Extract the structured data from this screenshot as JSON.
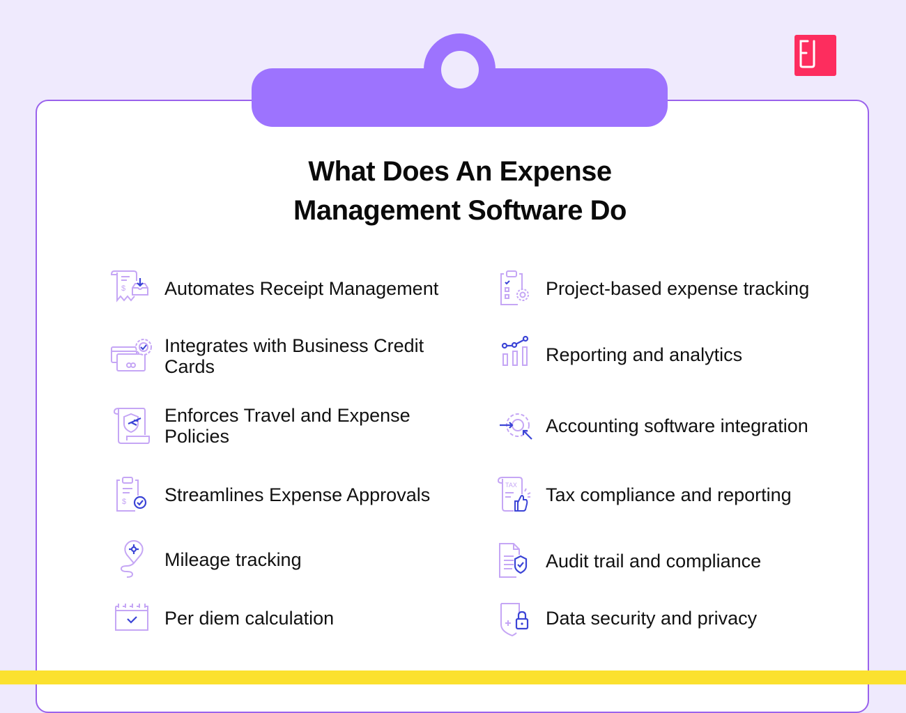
{
  "brand": {
    "logo_label": "FJ",
    "logo_color": "#fd2d5e"
  },
  "colors": {
    "background": "#efeafd",
    "accent": "#9d73fe",
    "border": "#9a62ec",
    "icon_light": "#c5a6f5",
    "icon_dark": "#3b44d6",
    "footer": "#fbe12f"
  },
  "title": {
    "line1": "What Does An Expense",
    "line2": "Management Software Do"
  },
  "left_column": [
    {
      "icon": "receipt-download-icon",
      "label": "Automates Receipt Management"
    },
    {
      "icon": "credit-card-gear-icon",
      "label": "Integrates with Business Credit Cards"
    },
    {
      "icon": "travel-policy-scroll-icon",
      "label": "Enforces Travel and Expense Policies"
    },
    {
      "icon": "clipboard-approval-icon",
      "label": "Streamlines Expense Approvals"
    },
    {
      "icon": "map-pin-route-icon",
      "label": "Mileage tracking"
    },
    {
      "icon": "calendar-check-icon",
      "label": "Per diem calculation"
    }
  ],
  "right_column": [
    {
      "icon": "clipboard-gear-icon",
      "label": "Project-based expense tracking"
    },
    {
      "icon": "bar-chart-trend-icon",
      "label": "Reporting and analytics"
    },
    {
      "icon": "gear-integration-icon",
      "label": "Accounting software integration"
    },
    {
      "icon": "tax-thumbs-up-icon",
      "label": "Tax compliance and reporting"
    },
    {
      "icon": "document-shield-icon",
      "label": "Audit trail and compliance"
    },
    {
      "icon": "shield-lock-icon",
      "label": "Data security and privacy"
    }
  ]
}
